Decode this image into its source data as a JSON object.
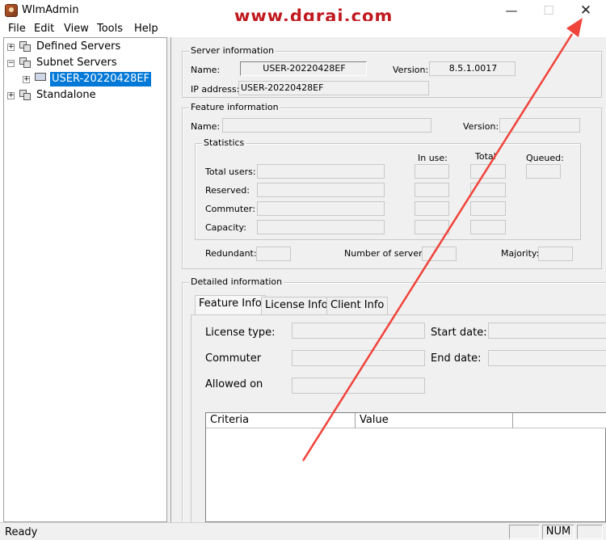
{
  "window": {
    "title": "WlmAdmin",
    "watermark": "www.dgrai.com",
    "minimize_glyph": "—",
    "maximize_glyph": "☐",
    "close_glyph": "✕"
  },
  "menu": {
    "items": [
      {
        "label": "File"
      },
      {
        "label": "Edit"
      },
      {
        "label": "View"
      },
      {
        "label": "Tools"
      },
      {
        "label": "Help"
      }
    ]
  },
  "tree": {
    "nodes": [
      {
        "label": "Defined Servers",
        "expander": "+",
        "icon": "server-group-icon"
      },
      {
        "label": "Subnet Servers",
        "expander": "−",
        "icon": "server-group-icon"
      },
      {
        "label": "USER-20220428EF",
        "expander": "+",
        "icon": "computer-icon",
        "selected": true
      },
      {
        "label": "Standalone",
        "expander": "+",
        "icon": "server-group-icon"
      }
    ]
  },
  "server_info": {
    "title": "Server information",
    "name_label": "Name:",
    "name_value": "USER-20220428EF",
    "version_label": "Version:",
    "version_value": "8.5.1.0017",
    "ip_label": "IP address:",
    "ip_value": "USER-20220428EF"
  },
  "feature_info": {
    "title": "Feature information",
    "name_label": "Name:",
    "version_label": "Version:",
    "statistics": {
      "title": "Statistics",
      "in_use_label": "In use:",
      "total_label": "Total",
      "queued_label": "Queued:",
      "rows": [
        "Total users:",
        "Reserved:",
        "Commuter:",
        "Capacity:"
      ]
    },
    "redundant_label": "Redundant:",
    "num_servers_label": "Number of servers:",
    "majority_label": "Majority:"
  },
  "detailed_info": {
    "title": "Detailed information",
    "tabs": [
      {
        "label": "Feature Info",
        "active": true
      },
      {
        "label": "License Info",
        "active": false
      },
      {
        "label": "Client Info",
        "active": false
      }
    ],
    "license_type_label": "License type:",
    "start_date_label": "Start date:",
    "commuter_label": "Commuter",
    "end_date_label": "End date:",
    "allowed_on_label": "Allowed on",
    "columns": [
      "Criteria",
      "Value"
    ]
  },
  "statusbar": {
    "text": "Ready",
    "num_indicator": "NUM"
  },
  "colors": {
    "selection": "#0078d7",
    "annotation_arrow": "#f0433a",
    "watermark": "#c0191f"
  }
}
